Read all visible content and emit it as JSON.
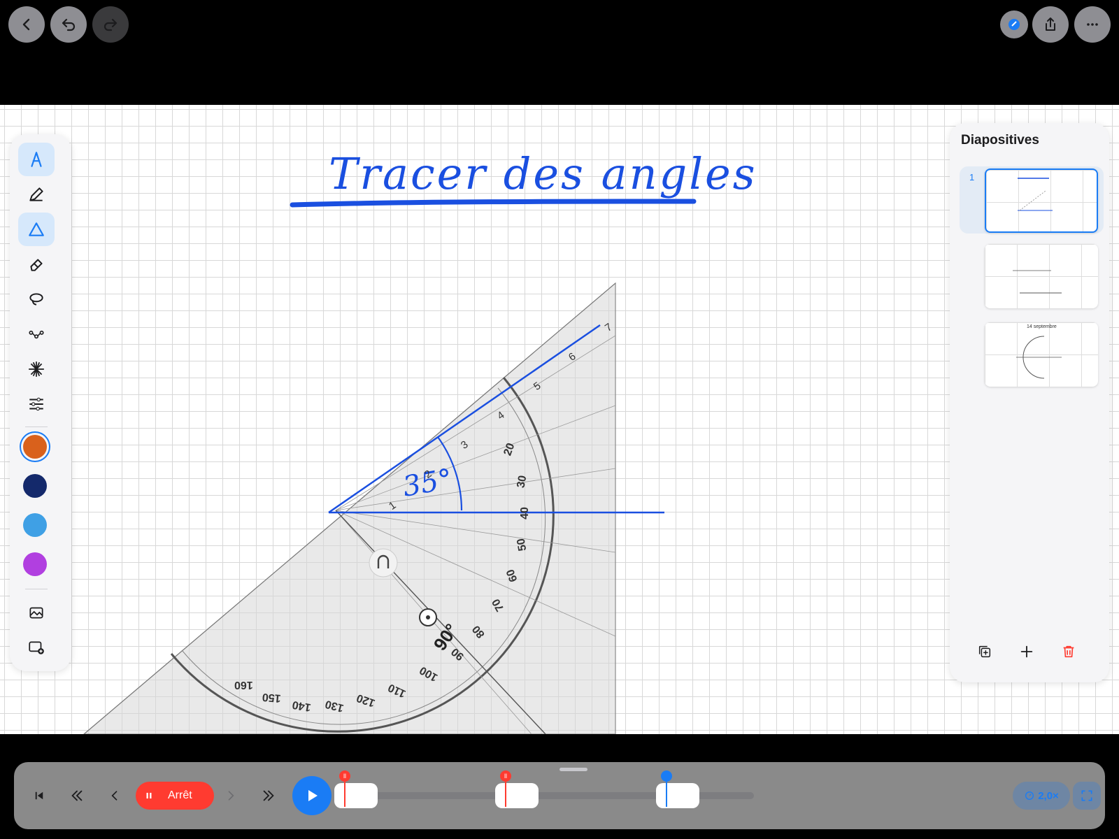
{
  "header": {
    "back_icon": "chevron-left-icon",
    "undo_icon": "undo-icon",
    "redo_icon": "redo-icon",
    "pen_mode_icon": "apple-pencil-icon",
    "share_icon": "share-icon",
    "more_icon": "ellipsis-icon"
  },
  "canvas": {
    "title": "Tracer des angles",
    "angle_annotation": "35°",
    "ruler_labels": [
      "1",
      "2",
      "3",
      "4",
      "5",
      "6",
      "7"
    ],
    "protractor_labels": [
      "20",
      "30",
      "40",
      "50",
      "60",
      "70",
      "80",
      "90",
      "100",
      "110",
      "120",
      "130",
      "140",
      "150",
      "160"
    ],
    "protractor_center": "90°"
  },
  "toolbar": {
    "tools": [
      "compass-icon",
      "pencil-icon",
      "triangle-ruler-icon",
      "eraser-icon",
      "lasso-icon",
      "node-graph-icon",
      "burst-icon",
      "sliders-icon"
    ],
    "colors": [
      "#d9611c",
      "#14296b",
      "#3fa0e5",
      "#b13fe0"
    ],
    "media": [
      "image-icon",
      "add-image-icon"
    ]
  },
  "slides": {
    "title": "Diapositives",
    "items": [
      {
        "number": "1",
        "selected": true
      },
      {
        "number": "",
        "selected": false
      },
      {
        "number": "",
        "selected": false
      }
    ],
    "thumb3_label": "14 septembre",
    "duplicate_icon": "duplicate-icon",
    "add_icon": "plus-icon",
    "delete_icon": "trash-icon"
  },
  "playback": {
    "first_icon": "skip-to-start-icon",
    "rewind_icon": "double-chevron-left-icon",
    "prev_icon": "chevron-left-icon",
    "stop_label": "Arrêt",
    "next_icon": "chevron-right-icon",
    "forward_icon": "double-chevron-right-icon",
    "play_icon": "play-icon",
    "speed_label": "2,0×",
    "fit_icon": "fit-screen-icon",
    "accent": "#1a7cf5",
    "stop_color": "#ff3b30"
  }
}
